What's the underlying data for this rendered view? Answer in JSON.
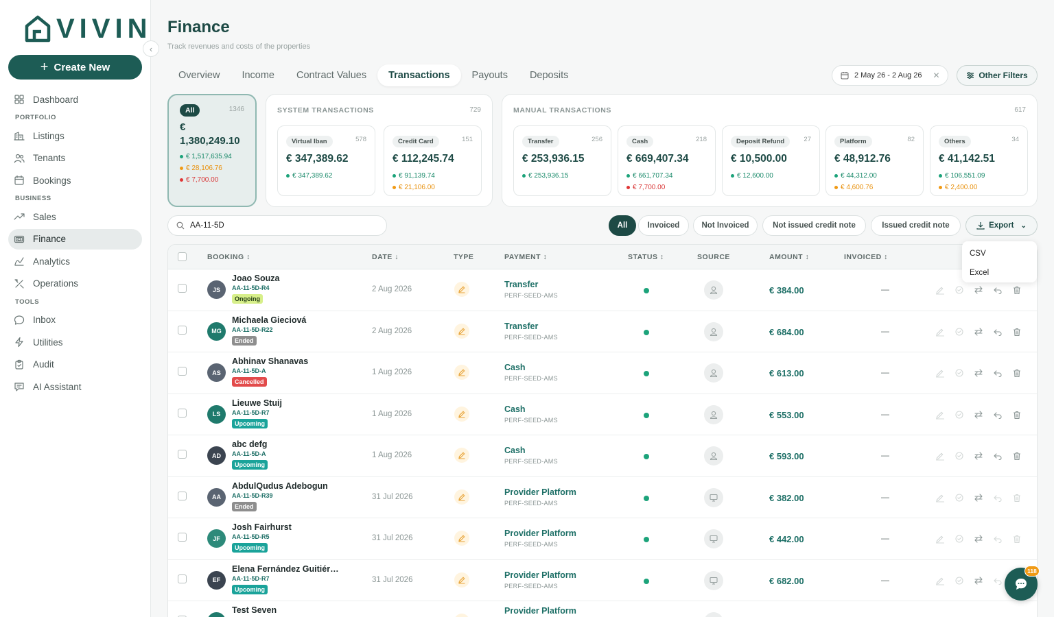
{
  "brand": {
    "logo_text": "VIVIN",
    "accent": "#1d5c55"
  },
  "sidebar": {
    "create_label": "Create New",
    "items": [
      {
        "label": "Dashboard",
        "icon": "grid-icon"
      },
      {
        "section": "PORTFOLIO"
      },
      {
        "label": "Listings",
        "icon": "building-icon"
      },
      {
        "label": "Tenants",
        "icon": "users-icon"
      },
      {
        "label": "Bookings",
        "icon": "calendar-icon"
      },
      {
        "section": "BUSINESS"
      },
      {
        "label": "Sales",
        "icon": "trend-icon"
      },
      {
        "label": "Finance",
        "icon": "money-icon",
        "active": true
      },
      {
        "label": "Analytics",
        "icon": "chart-icon"
      },
      {
        "label": "Operations",
        "icon": "tools-icon"
      },
      {
        "section": "TOOLS"
      },
      {
        "label": "Inbox",
        "icon": "chat-icon"
      },
      {
        "label": "Utilities",
        "icon": "bolt-icon"
      },
      {
        "label": "Audit",
        "icon": "clipboard-icon"
      },
      {
        "label": "AI Assistant",
        "icon": "ai-chat-icon"
      }
    ]
  },
  "header": {
    "title": "Finance",
    "subtitle": "Track revenues and costs of the properties",
    "tabs": [
      "Overview",
      "Income",
      "Contract Values",
      "Transactions",
      "Payouts",
      "Deposits"
    ],
    "active_tab": "Transactions",
    "date_range": "2 May 26 - 2 Aug 26",
    "other_filters": "Other Filters"
  },
  "summary": {
    "all": {
      "label": "All",
      "count": "1346",
      "amount": "€ 1,380,249.10",
      "green": "€ 1,517,635.94",
      "orange": "€ 28,106.76",
      "red": "€ 7,700.00"
    },
    "system": {
      "title": "SYSTEM TRANSACTIONS",
      "count": "729",
      "cards": [
        {
          "label": "Virtual Iban",
          "count": "578",
          "amount": "€ 347,389.62",
          "lines": [
            {
              "color": "green",
              "text": "€ 347,389.62"
            }
          ]
        },
        {
          "label": "Credit Card",
          "count": "151",
          "amount": "€ 112,245.74",
          "lines": [
            {
              "color": "green",
              "text": "€ 91,139.74"
            },
            {
              "color": "orange",
              "text": "€ 21,106.00"
            }
          ]
        }
      ]
    },
    "manual": {
      "title": "MANUAL TRANSACTIONS",
      "count": "617",
      "cards": [
        {
          "label": "Transfer",
          "count": "256",
          "amount": "€ 253,936.15",
          "lines": [
            {
              "color": "green",
              "text": "€ 253,936.15"
            }
          ]
        },
        {
          "label": "Cash",
          "count": "218",
          "amount": "€ 669,407.34",
          "lines": [
            {
              "color": "green",
              "text": "€ 661,707.34"
            },
            {
              "color": "red",
              "text": "€ 7,700.00"
            }
          ]
        },
        {
          "label": "Deposit Refund",
          "count": "27",
          "amount": "€ 10,500.00",
          "lines": [
            {
              "color": "green",
              "text": "€ 12,600.00"
            }
          ]
        },
        {
          "label": "Platform",
          "count": "82",
          "amount": "€ 48,912.76",
          "lines": [
            {
              "color": "green",
              "text": "€ 44,312.00"
            },
            {
              "color": "orange",
              "text": "€ 4,600.76"
            }
          ]
        },
        {
          "label": "Others",
          "count": "34",
          "amount": "€ 41,142.51",
          "lines": [
            {
              "color": "green",
              "text": "€ 106,551.09"
            },
            {
              "color": "orange",
              "text": "€ 2,400.00"
            }
          ]
        }
      ]
    }
  },
  "filters": {
    "search_value": "AA-11-5D",
    "chips": [
      "All",
      "Invoiced",
      "Not Invoiced",
      "Not issued credit note",
      "Issued credit note"
    ],
    "export_label": "Export",
    "export_options": [
      "CSV",
      "Excel"
    ]
  },
  "table": {
    "columns": [
      "BOOKING ↕",
      "DATE ↓",
      "TYPE",
      "PAYMENT ↕",
      "STATUS ↕",
      "SOURCE",
      "AMOUNT ↕",
      "INVOICED ↕"
    ],
    "rows": [
      {
        "initials": "JS",
        "avatar_color": "#5a6472",
        "name": "Joao Souza",
        "code": "AA-11-5D-R4",
        "badge": "Ongoing",
        "badge_class": "b-ongoing",
        "date": "2 Aug 2026",
        "payment": "Transfer",
        "payment_sub": "PERF-SEED-AMS",
        "source": "person-icon",
        "amount": "€ 384.00",
        "invoiced": "—"
      },
      {
        "initials": "MG",
        "avatar_color": "#1f7a6c",
        "name": "Michaela Gieciová",
        "code": "AA-11-5D-R22",
        "badge": "Ended",
        "badge_class": "b-ended",
        "date": "2 Aug 2026",
        "payment": "Transfer",
        "payment_sub": "PERF-SEED-AMS",
        "source": "person-icon",
        "amount": "€ 684.00",
        "invoiced": "—"
      },
      {
        "initials": "AS",
        "avatar_color": "#5a6472",
        "name": "Abhinav Shanavas",
        "code": "AA-11-5D-A",
        "badge": "Cancelled",
        "badge_class": "b-cancelled",
        "date": "1 Aug 2026",
        "payment": "Cash",
        "payment_sub": "PERF-SEED-AMS",
        "source": "person-icon",
        "amount": "€ 613.00",
        "invoiced": "—"
      },
      {
        "initials": "LS",
        "avatar_color": "#1f7a6c",
        "name": "Lieuwe Stuij",
        "code": "AA-11-5D-R7",
        "badge": "Upcoming",
        "badge_class": "b-upcoming",
        "date": "1 Aug 2026",
        "payment": "Cash",
        "payment_sub": "PERF-SEED-AMS",
        "source": "person-icon",
        "amount": "€ 553.00",
        "invoiced": "—"
      },
      {
        "initials": "AD",
        "avatar_color": "#3b4450",
        "name": "abc defg",
        "code": "AA-11-5D-A",
        "badge": "Upcoming",
        "badge_class": "b-upcoming",
        "date": "1 Aug 2026",
        "payment": "Cash",
        "payment_sub": "PERF-SEED-AMS",
        "source": "person-icon",
        "amount": "€ 593.00",
        "invoiced": "—"
      },
      {
        "initials": "AA",
        "avatar_color": "#5a6472",
        "name": "AbdulQudus Adebogun",
        "code": "AA-11-5D-R39",
        "badge": "Ended",
        "badge_class": "b-ended",
        "date": "31 Jul 2026",
        "payment": "Provider Platform",
        "payment_sub": "PERF-SEED-AMS",
        "source": "monitor-icon",
        "amount": "€ 382.00",
        "invoiced": "—"
      },
      {
        "initials": "JF",
        "avatar_color": "#2d8a7a",
        "name": "Josh Fairhurst",
        "code": "AA-11-5D-R5",
        "badge": "Upcoming",
        "badge_class": "b-upcoming",
        "date": "31 Jul 2026",
        "payment": "Provider Platform",
        "payment_sub": "PERF-SEED-AMS",
        "source": "monitor-icon",
        "amount": "€ 442.00",
        "invoiced": "—"
      },
      {
        "initials": "EF",
        "avatar_color": "#3b4450",
        "name": "Elena Fernández Guitiér…",
        "code": "AA-11-5D-R7",
        "badge": "Upcoming",
        "badge_class": "b-upcoming",
        "date": "31 Jul 2026",
        "payment": "Provider Platform",
        "payment_sub": "PERF-SEED-AMS",
        "source": "monitor-icon",
        "amount": "€ 682.00",
        "invoiced": "—"
      },
      {
        "initials": "TS",
        "avatar_color": "#1f7a6c",
        "name": "Test Seven",
        "code": "",
        "badge": "",
        "badge_class": "",
        "date": "",
        "payment": "Provider Platform",
        "payment_sub": "",
        "source": "monitor-icon",
        "amount": "",
        "invoiced": ""
      }
    ]
  },
  "chat": {
    "badge_count": "118"
  }
}
